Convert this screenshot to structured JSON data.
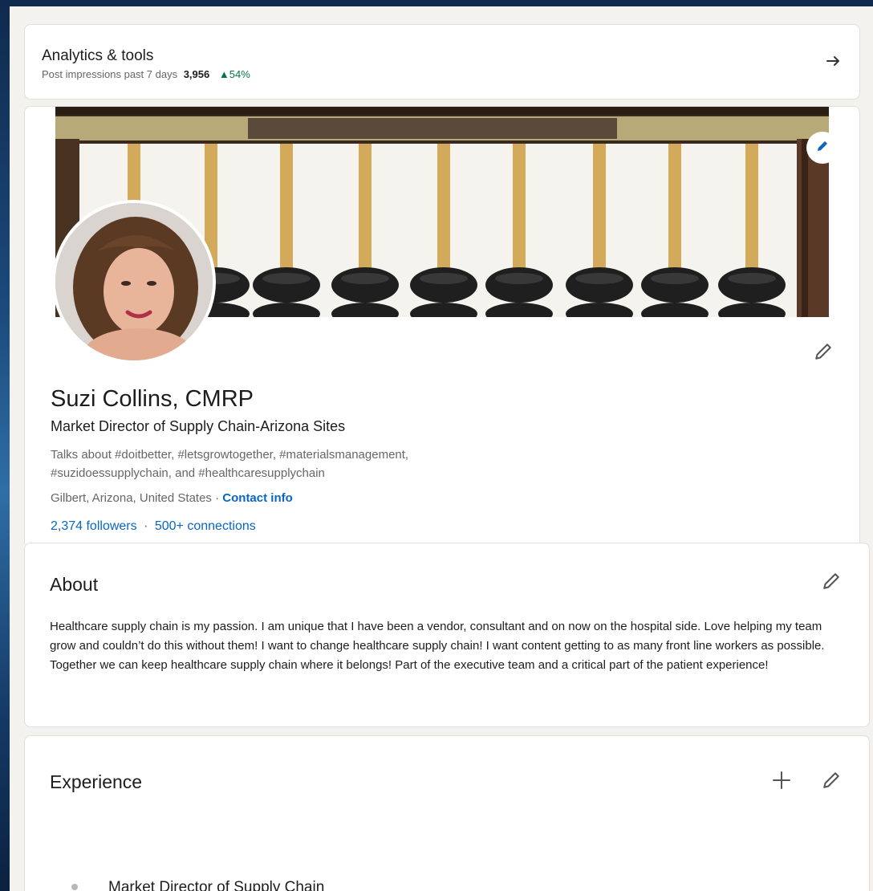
{
  "analytics": {
    "title": "Analytics & tools",
    "impressions_label": "Post impressions past 7 days",
    "impressions_value": "3,956",
    "impressions_change": "▲54%"
  },
  "profile": {
    "name": "Suzi Collins, CMRP",
    "headline": "Market Director of Supply Chain-Arizona Sites",
    "talks_about": "Talks about #doitbetter, #letsgrowtogether, #materialsmanagement, #suzidoessupplychain, and #healthcaresupplychain",
    "location": "Gilbert, Arizona, United States",
    "location_separator": " · ",
    "contact_info": "Contact info",
    "followers": "2,374 followers",
    "stats_separator": "·",
    "connections": "500+ connections"
  },
  "about": {
    "title": "About",
    "text": "Healthcare supply chain is my passion. I am unique that I have been a vendor, consultant and on now on the hospital side. Love helping my team grow and couldn’t do this without them! I want to change healthcare supply chain! I want content getting to as many front line workers as possible. Together we can keep healthcare supply chain where it belongs! Part of the executive team and a critical part of the patient experience!"
  },
  "experience": {
    "title": "Experience",
    "items": [
      {
        "title": "Market Director of Supply Chain"
      }
    ]
  },
  "colors": {
    "link": "#0a66c2",
    "positive": "#057642",
    "background": "#f3f2ef"
  },
  "icons": {
    "analytics_arrow": "arrow-right-icon",
    "banner_edit": "pencil-icon",
    "profile_edit": "pencil-icon",
    "about_edit": "pencil-icon",
    "experience_add": "plus-icon",
    "experience_edit": "pencil-icon"
  }
}
